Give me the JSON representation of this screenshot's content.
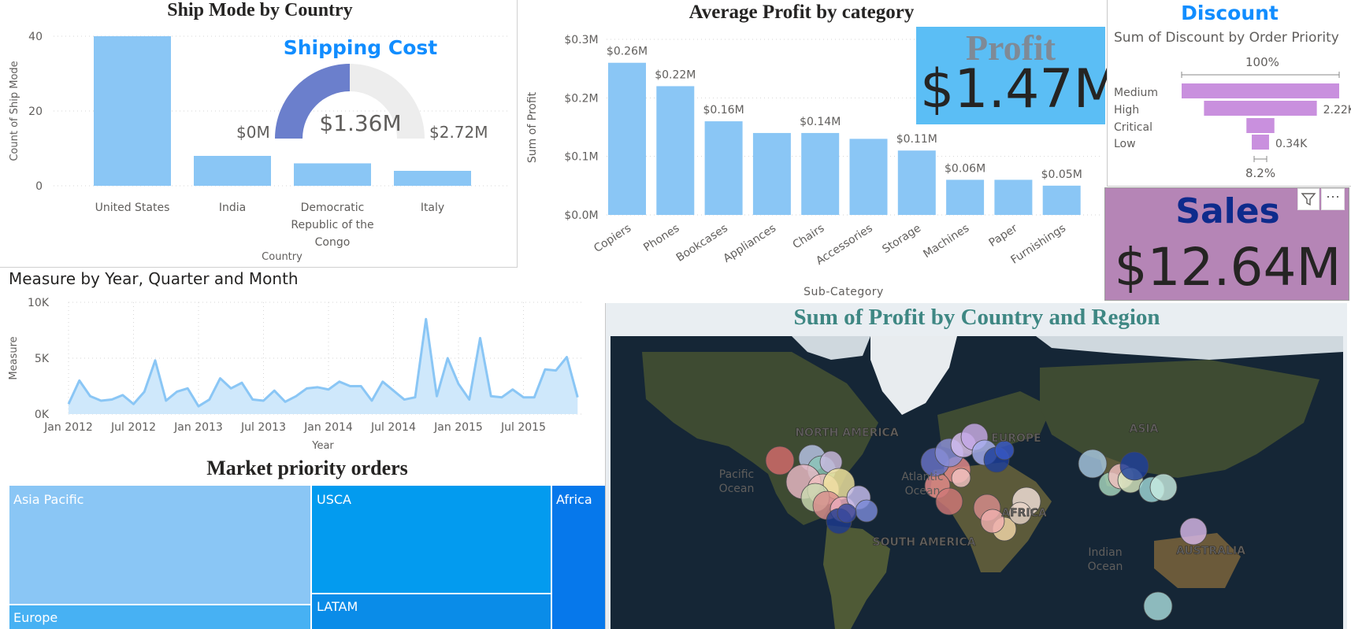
{
  "ship_mode": {
    "title": "Ship Mode by Country",
    "chart_data": {
      "type": "bar",
      "categories": [
        "United States",
        "India",
        "Democratic Republic of the Congo",
        "Italy"
      ],
      "values": [
        40,
        8,
        6,
        4
      ],
      "xlabel": "Country",
      "ylabel": "Count of Ship Mode",
      "ylim": [
        0,
        40
      ],
      "yticks": [
        "40",
        "20",
        "0"
      ]
    },
    "category_lines": [
      [
        "United States"
      ],
      [
        "India"
      ],
      [
        "Democratic",
        "Republic of the",
        "Congo"
      ],
      [
        "Italy"
      ]
    ]
  },
  "shipping_cost": {
    "title": "Shipping Cost",
    "value": "$1.36M",
    "min": "$0M",
    "max": "$2.72M",
    "fraction": 0.5,
    "fill_color": "#6B7FCC",
    "track_color": "#EDEDED"
  },
  "avg_profit": {
    "title": "Average Profit by category",
    "chart_data": {
      "type": "bar",
      "categories": [
        "Copiers",
        "Phones",
        "Bookcases",
        "Appliances",
        "Chairs",
        "Accessories",
        "Storage",
        "Machines",
        "Paper",
        "Furnishings"
      ],
      "values": [
        0.26,
        0.22,
        0.16,
        0.14,
        0.14,
        0.13,
        0.11,
        0.06,
        0.06,
        0.05
      ],
      "data_labels": [
        "$0.26M",
        "$0.22M",
        "$0.16M",
        "",
        "$0.14M",
        "",
        "$0.11M",
        "$0.06M",
        "",
        "$0.05M"
      ],
      "xlabel": "Sub-Category",
      "ylabel": "Sum of Profit",
      "ylim": [
        0,
        0.3
      ],
      "yticks": [
        "$0.3M",
        "$0.2M",
        "$0.1M",
        "$0.0M"
      ]
    }
  },
  "profit_card": {
    "label": "Profit",
    "value": "$1.47M",
    "bg": "#5BBEF5"
  },
  "discount": {
    "title": "Discount",
    "subtitle": "Sum of Discount by Order Priority",
    "top_pct": "100%",
    "bottom_pct": "8.2%",
    "chart_data": {
      "type": "bar",
      "categories": [
        "Medium",
        "High",
        "Critical",
        "Low"
      ],
      "values": [
        3.1,
        2.22,
        0.55,
        0.34
      ],
      "data_labels": [
        "",
        "2.22K",
        "",
        "0.34K"
      ]
    },
    "bar_color": "#C990DE"
  },
  "sales_card": {
    "label": "Sales",
    "value": "$12.64M",
    "bg": "#B585B6"
  },
  "measure": {
    "title": "Measure by Year, Quarter and Month",
    "chart_data": {
      "type": "area",
      "x": [
        "Jan 2012",
        "Feb 2012",
        "Mar 2012",
        "Apr 2012",
        "May 2012",
        "Jun 2012",
        "Jul 2012",
        "Aug 2012",
        "Sep 2012",
        "Oct 2012",
        "Nov 2012",
        "Dec 2012",
        "Jan 2013",
        "Feb 2013",
        "Mar 2013",
        "Apr 2013",
        "May 2013",
        "Jun 2013",
        "Jul 2013",
        "Aug 2013",
        "Sep 2013",
        "Oct 2013",
        "Nov 2013",
        "Dec 2013",
        "Jan 2014",
        "Feb 2014",
        "Mar 2014",
        "Apr 2014",
        "May 2014",
        "Jun 2014",
        "Jul 2014",
        "Aug 2014",
        "Sep 2014",
        "Oct 2014",
        "Nov 2014",
        "Dec 2014",
        "Jan 2015",
        "Feb 2015",
        "Mar 2015",
        "Apr 2015",
        "May 2015",
        "Jun 2015",
        "Jul 2015",
        "Aug 2015",
        "Sep 2015",
        "Oct 2015",
        "Nov 2015",
        "Dec 2015"
      ],
      "values": [
        900,
        3000,
        1600,
        1200,
        1300,
        1700,
        900,
        2000,
        4800,
        1200,
        2000,
        2300,
        700,
        1300,
        3200,
        2300,
        2800,
        1300,
        1200,
        2100,
        1100,
        1600,
        2300,
        2400,
        2200,
        2900,
        2500,
        2500,
        1200,
        2900,
        2100,
        1300,
        1500,
        8500,
        1600,
        5000,
        2700,
        1300,
        6800,
        1600,
        1500,
        2200,
        1500,
        1500,
        4000,
        3900,
        5100,
        1500
      ],
      "xlabel": "Year",
      "ylabel": "Measure",
      "ylim": [
        0,
        10000
      ],
      "yticks": [
        "10K",
        "5K",
        "0K"
      ],
      "xticks": [
        "Jan 2012",
        "Jul 2012",
        "Jan 2013",
        "Jul 2013",
        "Jan 2014",
        "Jul 2014",
        "Jan 2015",
        "Jul 2015"
      ]
    }
  },
  "market": {
    "title": "Market priority orders",
    "cells": [
      {
        "label": "Asia Pacific",
        "color": "#8AC6F5"
      },
      {
        "label": "Europe",
        "color": "#47B1F3"
      },
      {
        "label": "USCA",
        "color": "#039BEF"
      },
      {
        "label": "LATAM",
        "color": "#0A8CE8"
      },
      {
        "label": "Africa",
        "color": "#0678EB"
      }
    ]
  },
  "map": {
    "title": "Sum of Profit by Country and Region",
    "labels": [
      "NORTH AMERICA",
      "EUROPE",
      "ASIA",
      "AFRICA",
      "SOUTH AMERICA",
      "AUSTRALIA"
    ],
    "ocean_labels": [
      [
        "Pacific",
        "Ocean"
      ],
      [
        "Atlantic",
        "Ocean"
      ],
      [
        "Indian",
        "Ocean"
      ]
    ]
  },
  "toolbar": {
    "filter_icon": "filter-icon",
    "more_icon": "more-options-icon"
  }
}
